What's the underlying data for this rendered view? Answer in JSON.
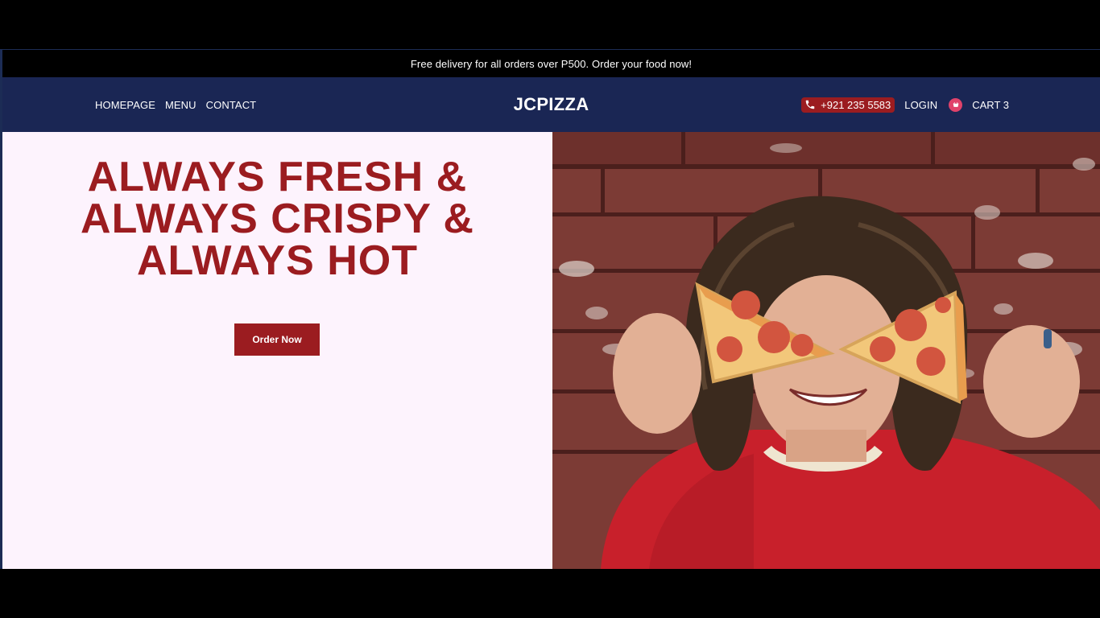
{
  "announcement": {
    "text": "Free delivery for all orders over P500. Order your food now!"
  },
  "nav": {
    "links": [
      {
        "label": "HOMEPAGE"
      },
      {
        "label": "MENU"
      },
      {
        "label": "CONTACT"
      }
    ],
    "brand": "JCPIZZA",
    "phone": "+921 235 5583",
    "phone_icon": "phone-icon",
    "login": "LOGIN",
    "cart_icon": "cart-icon",
    "cart_label": "CART 3"
  },
  "hero": {
    "title_lines": [
      "ALWAYS FRESH &",
      "ALWAYS CRISPY &",
      "ALWAYS HOT"
    ],
    "cta_label": "Order Now",
    "image_alt": "hero-photo"
  },
  "colors": {
    "brand_red": "#9b1c20",
    "nav_navy": "#1a2654",
    "hero_bg": "#fdf3fd",
    "cart_pink": "#e0426a"
  }
}
